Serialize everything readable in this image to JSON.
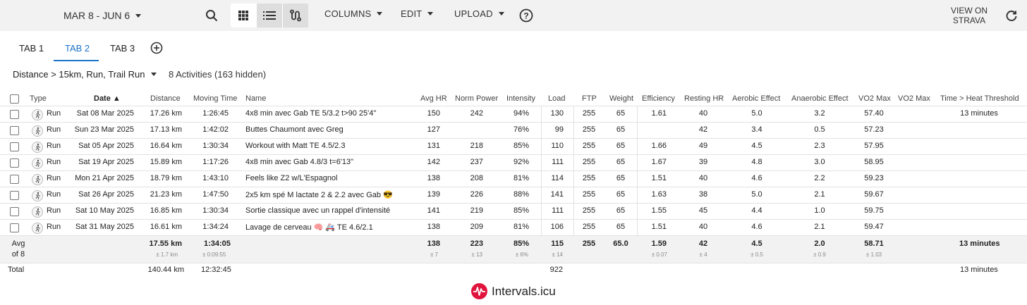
{
  "toolbar": {
    "date_range": "MAR 8 - JUN 6",
    "columns_label": "COLUMNS",
    "edit_label": "EDIT",
    "upload_label": "UPLOAD",
    "view_on_line1": "VIEW ON",
    "view_on_line2": "STRAVA"
  },
  "tabs": [
    {
      "label": "TAB 1",
      "active": false
    },
    {
      "label": "TAB 2",
      "active": true
    },
    {
      "label": "TAB 3",
      "active": false
    }
  ],
  "filter": {
    "label": "Distance > 15km, Run, Trail Run",
    "count": "8 Activities (163 hidden)"
  },
  "columns": [
    "Type",
    "Date ▲",
    "Distance",
    "Moving Time",
    "Name",
    "Avg HR",
    "Norm Power",
    "Intensity",
    "Load",
    "FTP",
    "Weight",
    "Efficiency",
    "Resting HR",
    "Aerobic Effect",
    "Anaerobic Effect",
    "VO2 Max",
    "VO2 Max",
    "Time > Heat Threshold"
  ],
  "rows": [
    {
      "type": "Run",
      "date": "Sat 08 Mar 2025",
      "distance": "17.26 km",
      "moving": "1:26:45",
      "name": "4x8 min avec Gab TE 5/3.2 t>90 25'4\"",
      "avg_hr": "150",
      "norm_power": "242",
      "intensity": "94%",
      "load": "130",
      "ftp": "255",
      "weight": "65",
      "efficiency": "1.61",
      "resting_hr": "40",
      "aerobic": "5.0",
      "anaerobic": "3.2",
      "vo2": "57.40",
      "vo2b": "",
      "heat": "13 minutes"
    },
    {
      "type": "Run",
      "date": "Sun 23 Mar 2025",
      "distance": "17.13 km",
      "moving": "1:42:02",
      "name": "Buttes Chaumont avec Greg",
      "avg_hr": "127",
      "norm_power": "",
      "intensity": "76%",
      "load": "99",
      "ftp": "255",
      "weight": "65",
      "efficiency": "",
      "resting_hr": "42",
      "aerobic": "3.4",
      "anaerobic": "0.5",
      "vo2": "57.23",
      "vo2b": "",
      "heat": ""
    },
    {
      "type": "Run",
      "date": "Sat 05 Apr 2025",
      "distance": "16.64 km",
      "moving": "1:30:34",
      "name": "Workout with Matt TE 4.5/2.3",
      "avg_hr": "131",
      "norm_power": "218",
      "intensity": "85%",
      "load": "110",
      "ftp": "255",
      "weight": "65",
      "efficiency": "1.66",
      "resting_hr": "49",
      "aerobic": "4.5",
      "anaerobic": "2.3",
      "vo2": "57.95",
      "vo2b": "",
      "heat": ""
    },
    {
      "type": "Run",
      "date": "Sat 19 Apr 2025",
      "distance": "15.89 km",
      "moving": "1:17:26",
      "name": "4x8 min avec Gab 4.8/3 t=6'13\"",
      "avg_hr": "142",
      "norm_power": "237",
      "intensity": "92%",
      "load": "111",
      "ftp": "255",
      "weight": "65",
      "efficiency": "1.67",
      "resting_hr": "39",
      "aerobic": "4.8",
      "anaerobic": "3.0",
      "vo2": "58.95",
      "vo2b": "",
      "heat": ""
    },
    {
      "type": "Run",
      "date": "Mon 21 Apr 2025",
      "distance": "18.79 km",
      "moving": "1:43:10",
      "name": "Feels like Z2 w/L'Espagnol",
      "avg_hr": "138",
      "norm_power": "208",
      "intensity": "81%",
      "load": "114",
      "ftp": "255",
      "weight": "65",
      "efficiency": "1.51",
      "resting_hr": "40",
      "aerobic": "4.6",
      "anaerobic": "2.2",
      "vo2": "59.23",
      "vo2b": "",
      "heat": ""
    },
    {
      "type": "Run",
      "date": "Sat 26 Apr 2025",
      "distance": "21.23 km",
      "moving": "1:47:50",
      "name": "2x5 km spé M lactate 2 & 2.2 avec Gab 😎",
      "avg_hr": "139",
      "norm_power": "226",
      "intensity": "88%",
      "load": "141",
      "ftp": "255",
      "weight": "65",
      "efficiency": "1.63",
      "resting_hr": "38",
      "aerobic": "5.0",
      "anaerobic": "2.1",
      "vo2": "59.67",
      "vo2b": "",
      "heat": ""
    },
    {
      "type": "Run",
      "date": "Sat 10 May 2025",
      "distance": "16.85 km",
      "moving": "1:30:34",
      "name": "Sortie classique avec un rappel d'intensité",
      "avg_hr": "141",
      "norm_power": "219",
      "intensity": "85%",
      "load": "111",
      "ftp": "255",
      "weight": "65",
      "efficiency": "1.55",
      "resting_hr": "45",
      "aerobic": "4.4",
      "anaerobic": "1.0",
      "vo2": "59.75",
      "vo2b": "",
      "heat": ""
    },
    {
      "type": "Run",
      "date": "Sat 31 May 2025",
      "distance": "16.61 km",
      "moving": "1:34:24",
      "name": "Lavage de cerveau 🧠 🚑 TE 4.6/2.1",
      "avg_hr": "138",
      "norm_power": "209",
      "intensity": "81%",
      "load": "106",
      "ftp": "255",
      "weight": "65",
      "efficiency": "1.51",
      "resting_hr": "40",
      "aerobic": "4.6",
      "anaerobic": "2.1",
      "vo2": "59.47",
      "vo2b": "",
      "heat": ""
    }
  ],
  "average": {
    "label_line1": "Avg",
    "label_line2": "of 8",
    "distance": "17.55 km",
    "distance_sd": "± 1.7 km",
    "moving": "1:34:05",
    "moving_sd": "± 0:09:55",
    "avg_hr": "138",
    "avg_hr_sd": "± 7",
    "norm_power": "223",
    "norm_power_sd": "± 13",
    "intensity": "85%",
    "intensity_sd": "± 6%",
    "load": "115",
    "load_sd": "± 14",
    "ftp": "255",
    "weight": "65.0",
    "efficiency": "1.59",
    "efficiency_sd": "± 0.07",
    "resting_hr": "42",
    "resting_hr_sd": "± 4",
    "aerobic": "4.5",
    "aerobic_sd": "± 0.5",
    "anaerobic": "2.0",
    "anaerobic_sd": "± 0.9",
    "vo2": "58.71",
    "vo2_sd": "± 1.03",
    "heat": "13 minutes"
  },
  "total": {
    "label": "Total",
    "distance": "140.44 km",
    "moving": "12:32:45",
    "load": "922",
    "heat": "13 minutes"
  },
  "footer": {
    "brand": "Intervals.icu"
  },
  "colors": {
    "accent": "#1a73c8",
    "brand": "#e0143c"
  }
}
